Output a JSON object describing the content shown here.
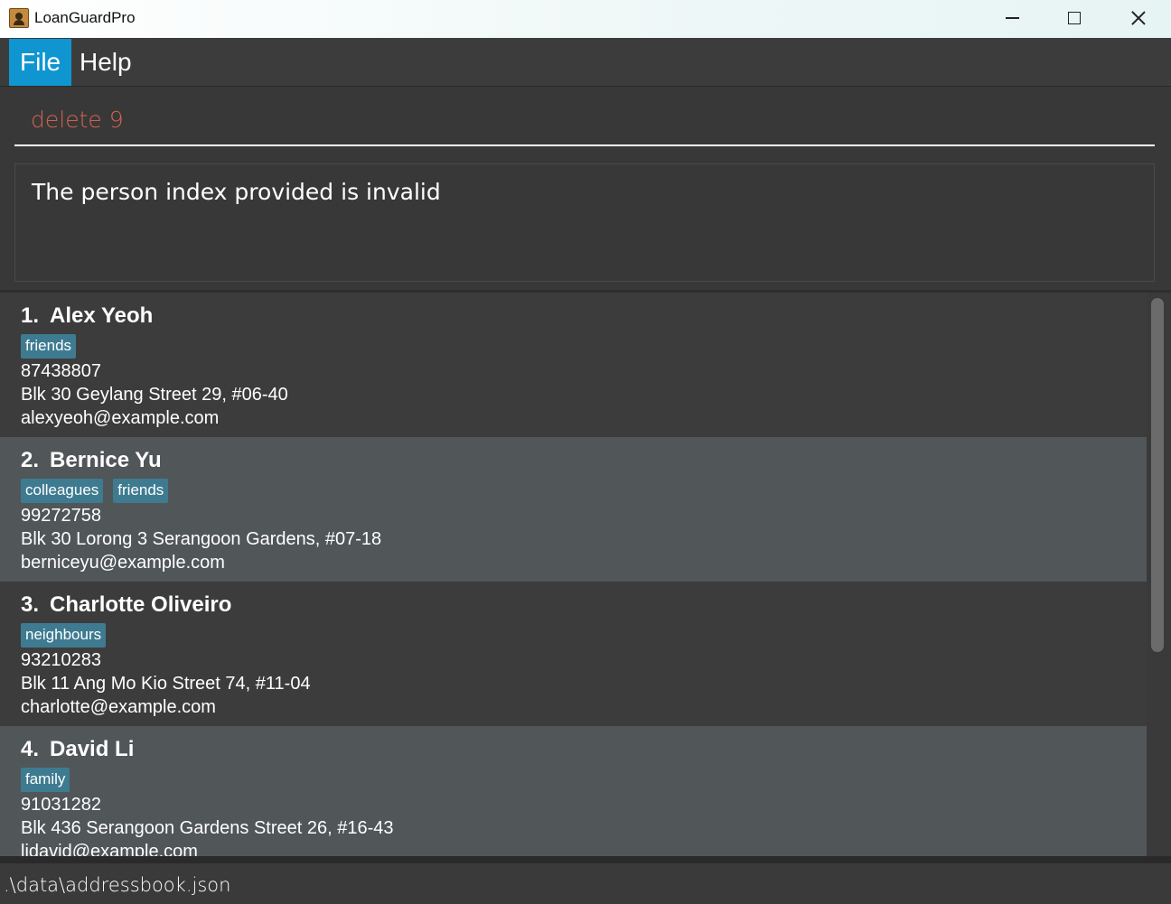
{
  "window": {
    "title": "LoanGuardPro"
  },
  "menu": {
    "file": "File",
    "help": "Help"
  },
  "command": {
    "value": "delete 9"
  },
  "result": {
    "message": "The person index provided is invalid"
  },
  "persons": [
    {
      "index": "1.",
      "name": "Alex Yeoh",
      "tags": [
        "friends"
      ],
      "phone": "87438807",
      "address": "Blk 30 Geylang Street 29, #06-40",
      "email": "alexyeoh@example.com"
    },
    {
      "index": "2.",
      "name": "Bernice Yu",
      "tags": [
        "colleagues",
        "friends"
      ],
      "phone": "99272758",
      "address": "Blk 30 Lorong 3 Serangoon Gardens, #07-18",
      "email": "berniceyu@example.com"
    },
    {
      "index": "3.",
      "name": "Charlotte Oliveiro",
      "tags": [
        "neighbours"
      ],
      "phone": "93210283",
      "address": "Blk 11 Ang Mo Kio Street 74, #11-04",
      "email": "charlotte@example.com"
    },
    {
      "index": "4.",
      "name": "David Li",
      "tags": [
        "family"
      ],
      "phone": "91031282",
      "address": "Blk 436 Serangoon Gardens Street 26, #16-43",
      "email": "lidavid@example.com"
    }
  ],
  "status": {
    "file_path": ".\\data\\addressbook.json"
  },
  "colors": {
    "accent": "#0f96d1",
    "tag": "#3e7b91",
    "command_text": "#d0634f"
  }
}
